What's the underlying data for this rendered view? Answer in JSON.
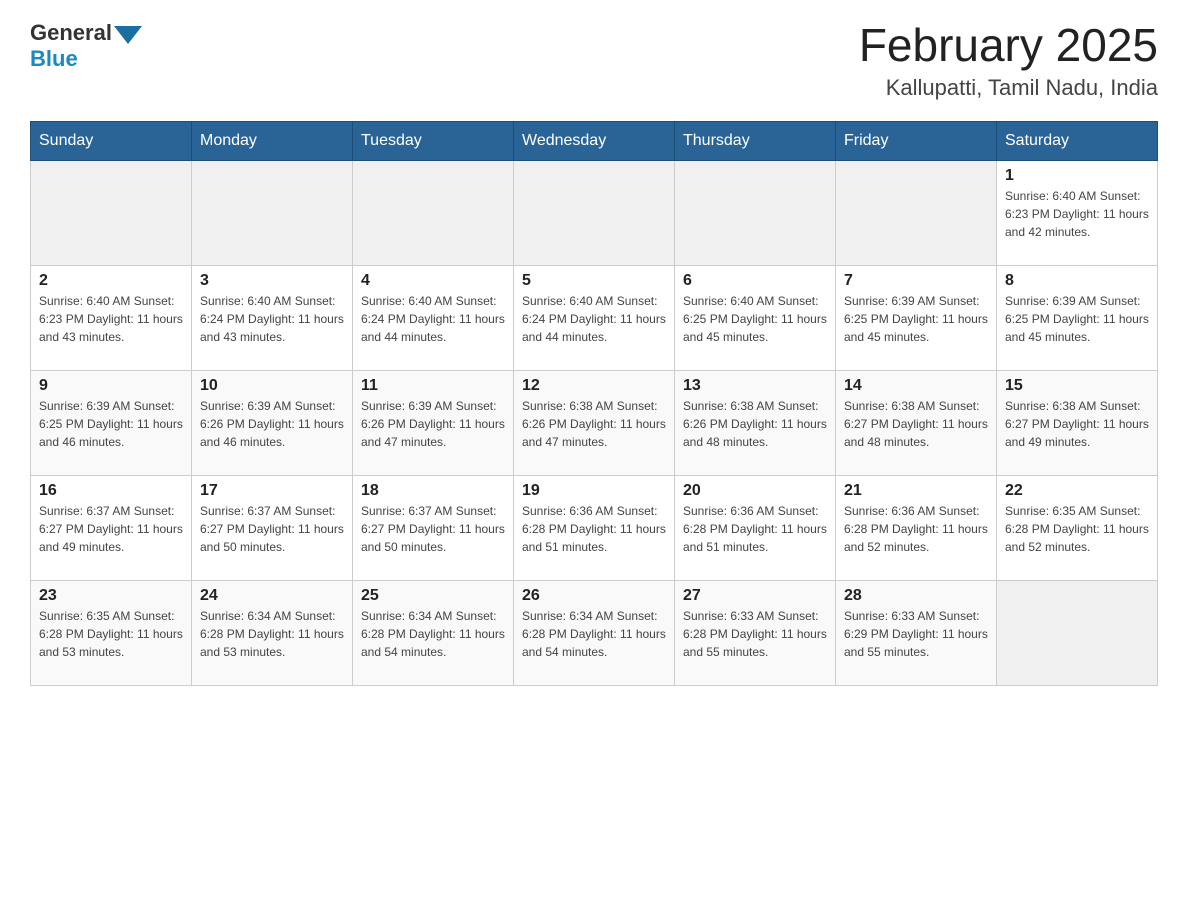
{
  "header": {
    "logo_general": "General",
    "logo_blue": "Blue",
    "month_year": "February 2025",
    "location": "Kallupatti, Tamil Nadu, India"
  },
  "days_of_week": [
    "Sunday",
    "Monday",
    "Tuesday",
    "Wednesday",
    "Thursday",
    "Friday",
    "Saturday"
  ],
  "weeks": [
    [
      {
        "day": "",
        "info": ""
      },
      {
        "day": "",
        "info": ""
      },
      {
        "day": "",
        "info": ""
      },
      {
        "day": "",
        "info": ""
      },
      {
        "day": "",
        "info": ""
      },
      {
        "day": "",
        "info": ""
      },
      {
        "day": "1",
        "info": "Sunrise: 6:40 AM\nSunset: 6:23 PM\nDaylight: 11 hours\nand 42 minutes."
      }
    ],
    [
      {
        "day": "2",
        "info": "Sunrise: 6:40 AM\nSunset: 6:23 PM\nDaylight: 11 hours\nand 43 minutes."
      },
      {
        "day": "3",
        "info": "Sunrise: 6:40 AM\nSunset: 6:24 PM\nDaylight: 11 hours\nand 43 minutes."
      },
      {
        "day": "4",
        "info": "Sunrise: 6:40 AM\nSunset: 6:24 PM\nDaylight: 11 hours\nand 44 minutes."
      },
      {
        "day": "5",
        "info": "Sunrise: 6:40 AM\nSunset: 6:24 PM\nDaylight: 11 hours\nand 44 minutes."
      },
      {
        "day": "6",
        "info": "Sunrise: 6:40 AM\nSunset: 6:25 PM\nDaylight: 11 hours\nand 45 minutes."
      },
      {
        "day": "7",
        "info": "Sunrise: 6:39 AM\nSunset: 6:25 PM\nDaylight: 11 hours\nand 45 minutes."
      },
      {
        "day": "8",
        "info": "Sunrise: 6:39 AM\nSunset: 6:25 PM\nDaylight: 11 hours\nand 45 minutes."
      }
    ],
    [
      {
        "day": "9",
        "info": "Sunrise: 6:39 AM\nSunset: 6:25 PM\nDaylight: 11 hours\nand 46 minutes."
      },
      {
        "day": "10",
        "info": "Sunrise: 6:39 AM\nSunset: 6:26 PM\nDaylight: 11 hours\nand 46 minutes."
      },
      {
        "day": "11",
        "info": "Sunrise: 6:39 AM\nSunset: 6:26 PM\nDaylight: 11 hours\nand 47 minutes."
      },
      {
        "day": "12",
        "info": "Sunrise: 6:38 AM\nSunset: 6:26 PM\nDaylight: 11 hours\nand 47 minutes."
      },
      {
        "day": "13",
        "info": "Sunrise: 6:38 AM\nSunset: 6:26 PM\nDaylight: 11 hours\nand 48 minutes."
      },
      {
        "day": "14",
        "info": "Sunrise: 6:38 AM\nSunset: 6:27 PM\nDaylight: 11 hours\nand 48 minutes."
      },
      {
        "day": "15",
        "info": "Sunrise: 6:38 AM\nSunset: 6:27 PM\nDaylight: 11 hours\nand 49 minutes."
      }
    ],
    [
      {
        "day": "16",
        "info": "Sunrise: 6:37 AM\nSunset: 6:27 PM\nDaylight: 11 hours\nand 49 minutes."
      },
      {
        "day": "17",
        "info": "Sunrise: 6:37 AM\nSunset: 6:27 PM\nDaylight: 11 hours\nand 50 minutes."
      },
      {
        "day": "18",
        "info": "Sunrise: 6:37 AM\nSunset: 6:27 PM\nDaylight: 11 hours\nand 50 minutes."
      },
      {
        "day": "19",
        "info": "Sunrise: 6:36 AM\nSunset: 6:28 PM\nDaylight: 11 hours\nand 51 minutes."
      },
      {
        "day": "20",
        "info": "Sunrise: 6:36 AM\nSunset: 6:28 PM\nDaylight: 11 hours\nand 51 minutes."
      },
      {
        "day": "21",
        "info": "Sunrise: 6:36 AM\nSunset: 6:28 PM\nDaylight: 11 hours\nand 52 minutes."
      },
      {
        "day": "22",
        "info": "Sunrise: 6:35 AM\nSunset: 6:28 PM\nDaylight: 11 hours\nand 52 minutes."
      }
    ],
    [
      {
        "day": "23",
        "info": "Sunrise: 6:35 AM\nSunset: 6:28 PM\nDaylight: 11 hours\nand 53 minutes."
      },
      {
        "day": "24",
        "info": "Sunrise: 6:34 AM\nSunset: 6:28 PM\nDaylight: 11 hours\nand 53 minutes."
      },
      {
        "day": "25",
        "info": "Sunrise: 6:34 AM\nSunset: 6:28 PM\nDaylight: 11 hours\nand 54 minutes."
      },
      {
        "day": "26",
        "info": "Sunrise: 6:34 AM\nSunset: 6:28 PM\nDaylight: 11 hours\nand 54 minutes."
      },
      {
        "day": "27",
        "info": "Sunrise: 6:33 AM\nSunset: 6:28 PM\nDaylight: 11 hours\nand 55 minutes."
      },
      {
        "day": "28",
        "info": "Sunrise: 6:33 AM\nSunset: 6:29 PM\nDaylight: 11 hours\nand 55 minutes."
      },
      {
        "day": "",
        "info": ""
      }
    ]
  ]
}
